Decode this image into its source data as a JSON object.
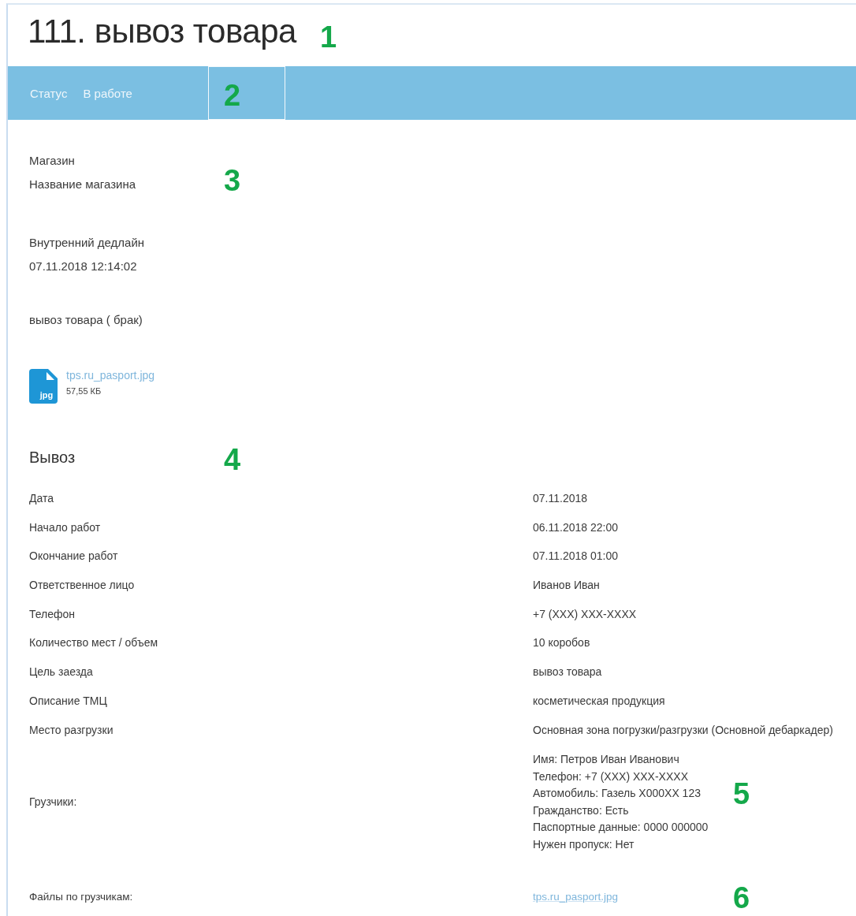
{
  "title": "111. вывоз товара",
  "status_bar": {
    "label": "Статус",
    "value": "В работе"
  },
  "store": {
    "label": "Магазин",
    "value": "Название магазина"
  },
  "deadline": {
    "label": "Внутренний дедлайн",
    "value": "07.11.2018 12:14:02"
  },
  "description": "вывоз товара ( брак)",
  "attachment": {
    "type": "jpg",
    "name": "tps.ru_pasport.jpg",
    "size": "57,55 КБ"
  },
  "section": {
    "title": "Вывоз",
    "rows": [
      {
        "label": "Дата",
        "value": "07.11.2018"
      },
      {
        "label": "Начало работ",
        "value": "06.11.2018 22:00"
      },
      {
        "label": "Окончание работ",
        "value": "07.11.2018 01:00"
      },
      {
        "label": "Ответственное лицо",
        "value": "Иванов Иван"
      },
      {
        "label": "Телефон",
        "value": "+7 (XXX) XXX-XXXX"
      },
      {
        "label": "Количество мест / объем",
        "value": "10 коробов"
      },
      {
        "label": "Цель заезда",
        "value": "вывоз товара"
      },
      {
        "label": "Описание ТМЦ",
        "value": "косметическая продукция"
      },
      {
        "label": "Место разгрузки",
        "value": "Основная зона погрузки/разгрузки (Основной дебаркадер)"
      }
    ]
  },
  "loaders": {
    "label": "Грузчики:",
    "lines": [
      "Имя: Петров Иван Иванович",
      "Телефон: +7 (XXX) XXX-XXXX",
      "Автомобиль: Газель Х000ХХ 123",
      "Гражданство: Есть",
      "Паспортные данные: 0000 000000",
      "Нужен пропуск: Нет"
    ]
  },
  "loader_files": {
    "label": "Файлы по грузчикам:",
    "link": "tps.ru_pasport.jpg"
  },
  "markers": [
    "1",
    "2",
    "3",
    "4",
    "5",
    "6"
  ]
}
